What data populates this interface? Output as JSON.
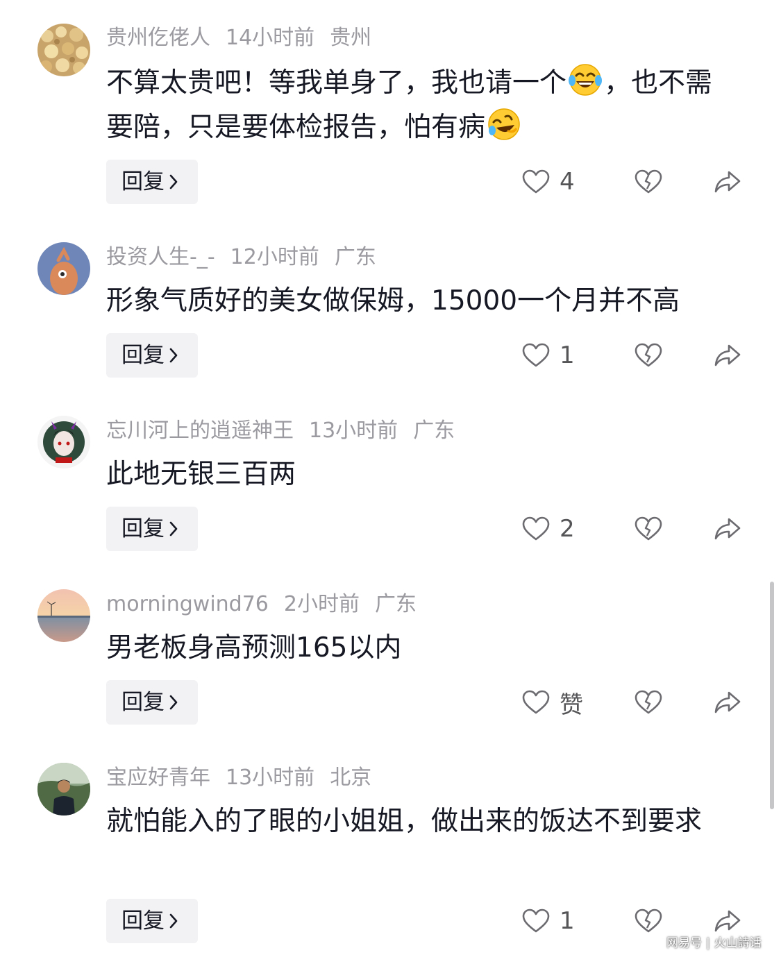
{
  "comments": [
    {
      "username": "贵州仡佬人",
      "time": "14小时前",
      "location": "贵州",
      "text_a": "不算太贵吧！等我单身了，我也请一个",
      "text_b": "，也不需要陪，只是要体检报告，怕有病",
      "text_c": "",
      "emoji_a": "tears-of-joy-emoji",
      "emoji_b": "rolling-laughing-emoji",
      "reply_label": "回复",
      "like_count": "4",
      "like_color": "#6b6b70",
      "avatar_icon": "mushroom-photo-avatar"
    },
    {
      "username": "投资人生-_-",
      "time": "12小时前",
      "location": "广东",
      "text": "形象气质好的美女做保姆，15000一个月并不高",
      "reply_label": "回复",
      "like_count": "1",
      "avatar_icon": "cartoon-character-avatar"
    },
    {
      "username": "忘川河上的逍遥神王",
      "time": "13小时前",
      "location": "广东",
      "text": "此地无银三百两",
      "reply_label": "回复",
      "like_count": "2",
      "avatar_icon": "anime-demon-avatar"
    },
    {
      "username": "morningwind76",
      "time": "2小时前",
      "location": "广东",
      "text": "男老板身高预测165以内",
      "reply_label": "回复",
      "like_count": "赞",
      "avatar_icon": "sunset-sea-avatar"
    },
    {
      "username": "宝应好青年",
      "time": "13小时前",
      "location": "北京",
      "text": "就怕能入的了眼的小姐姐，做出来的饭达不到要求",
      "reply_label": "回复",
      "like_count": "1",
      "avatar_icon": "man-photo-avatar"
    }
  ],
  "icons": {
    "like": "heart-icon",
    "dislike": "broken-heart-icon",
    "share": "share-arrow-icon",
    "reply_chevron": "chevron-right-icon"
  },
  "watermark": {
    "left": "网易号",
    "right": "火山詩话"
  },
  "colors": {
    "text": "#161823",
    "meta": "#9a9aa0",
    "icon": "#6b6b70",
    "reply_bg": "#f2f2f4"
  }
}
